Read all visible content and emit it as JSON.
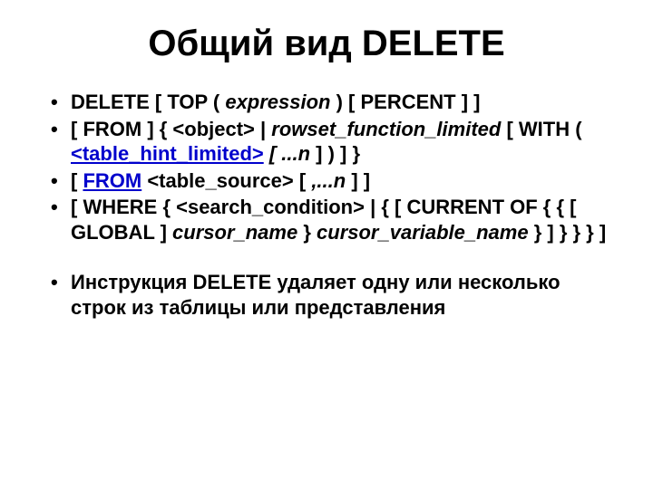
{
  "title": "Общий вид DELETE",
  "b1_delete": "DELETE",
  "b1_top": "    [ TOP (",
  "b1_expr": " expression ",
  "b1_after_expr": ") [ PERCENT ] ]",
  "b2_from": "[ FROM ]     { <object> |",
  "b2_rowset": " rowset_function_limited ",
  "b2_bracket": "  [ WITH (",
  "b2_hint": " <table_hint_limited>",
  "b2_dotsn": " [ ...n",
  "b2_close": " ] ) ]     }",
  "b3_open": "[ ",
  "b3_from": "FROM",
  "b3_tsrc": " <table_source> [ ",
  "b3_dotsn": ",...n",
  "b3_close": " ] ]",
  "b4_where": "[ WHERE { <search_condition> | { [ CURRENT OF  { { [ GLOBAL ] ",
  "b4_cursor": "cursor_name",
  "b4_mid": " } ",
  "b4_cvn": "cursor_variable_name ",
  "b4_tail": " }  ]  }  }  }  ]",
  "desc": "Инструкция DELETE удаляет одну или несколько строк из таблицы или представления"
}
